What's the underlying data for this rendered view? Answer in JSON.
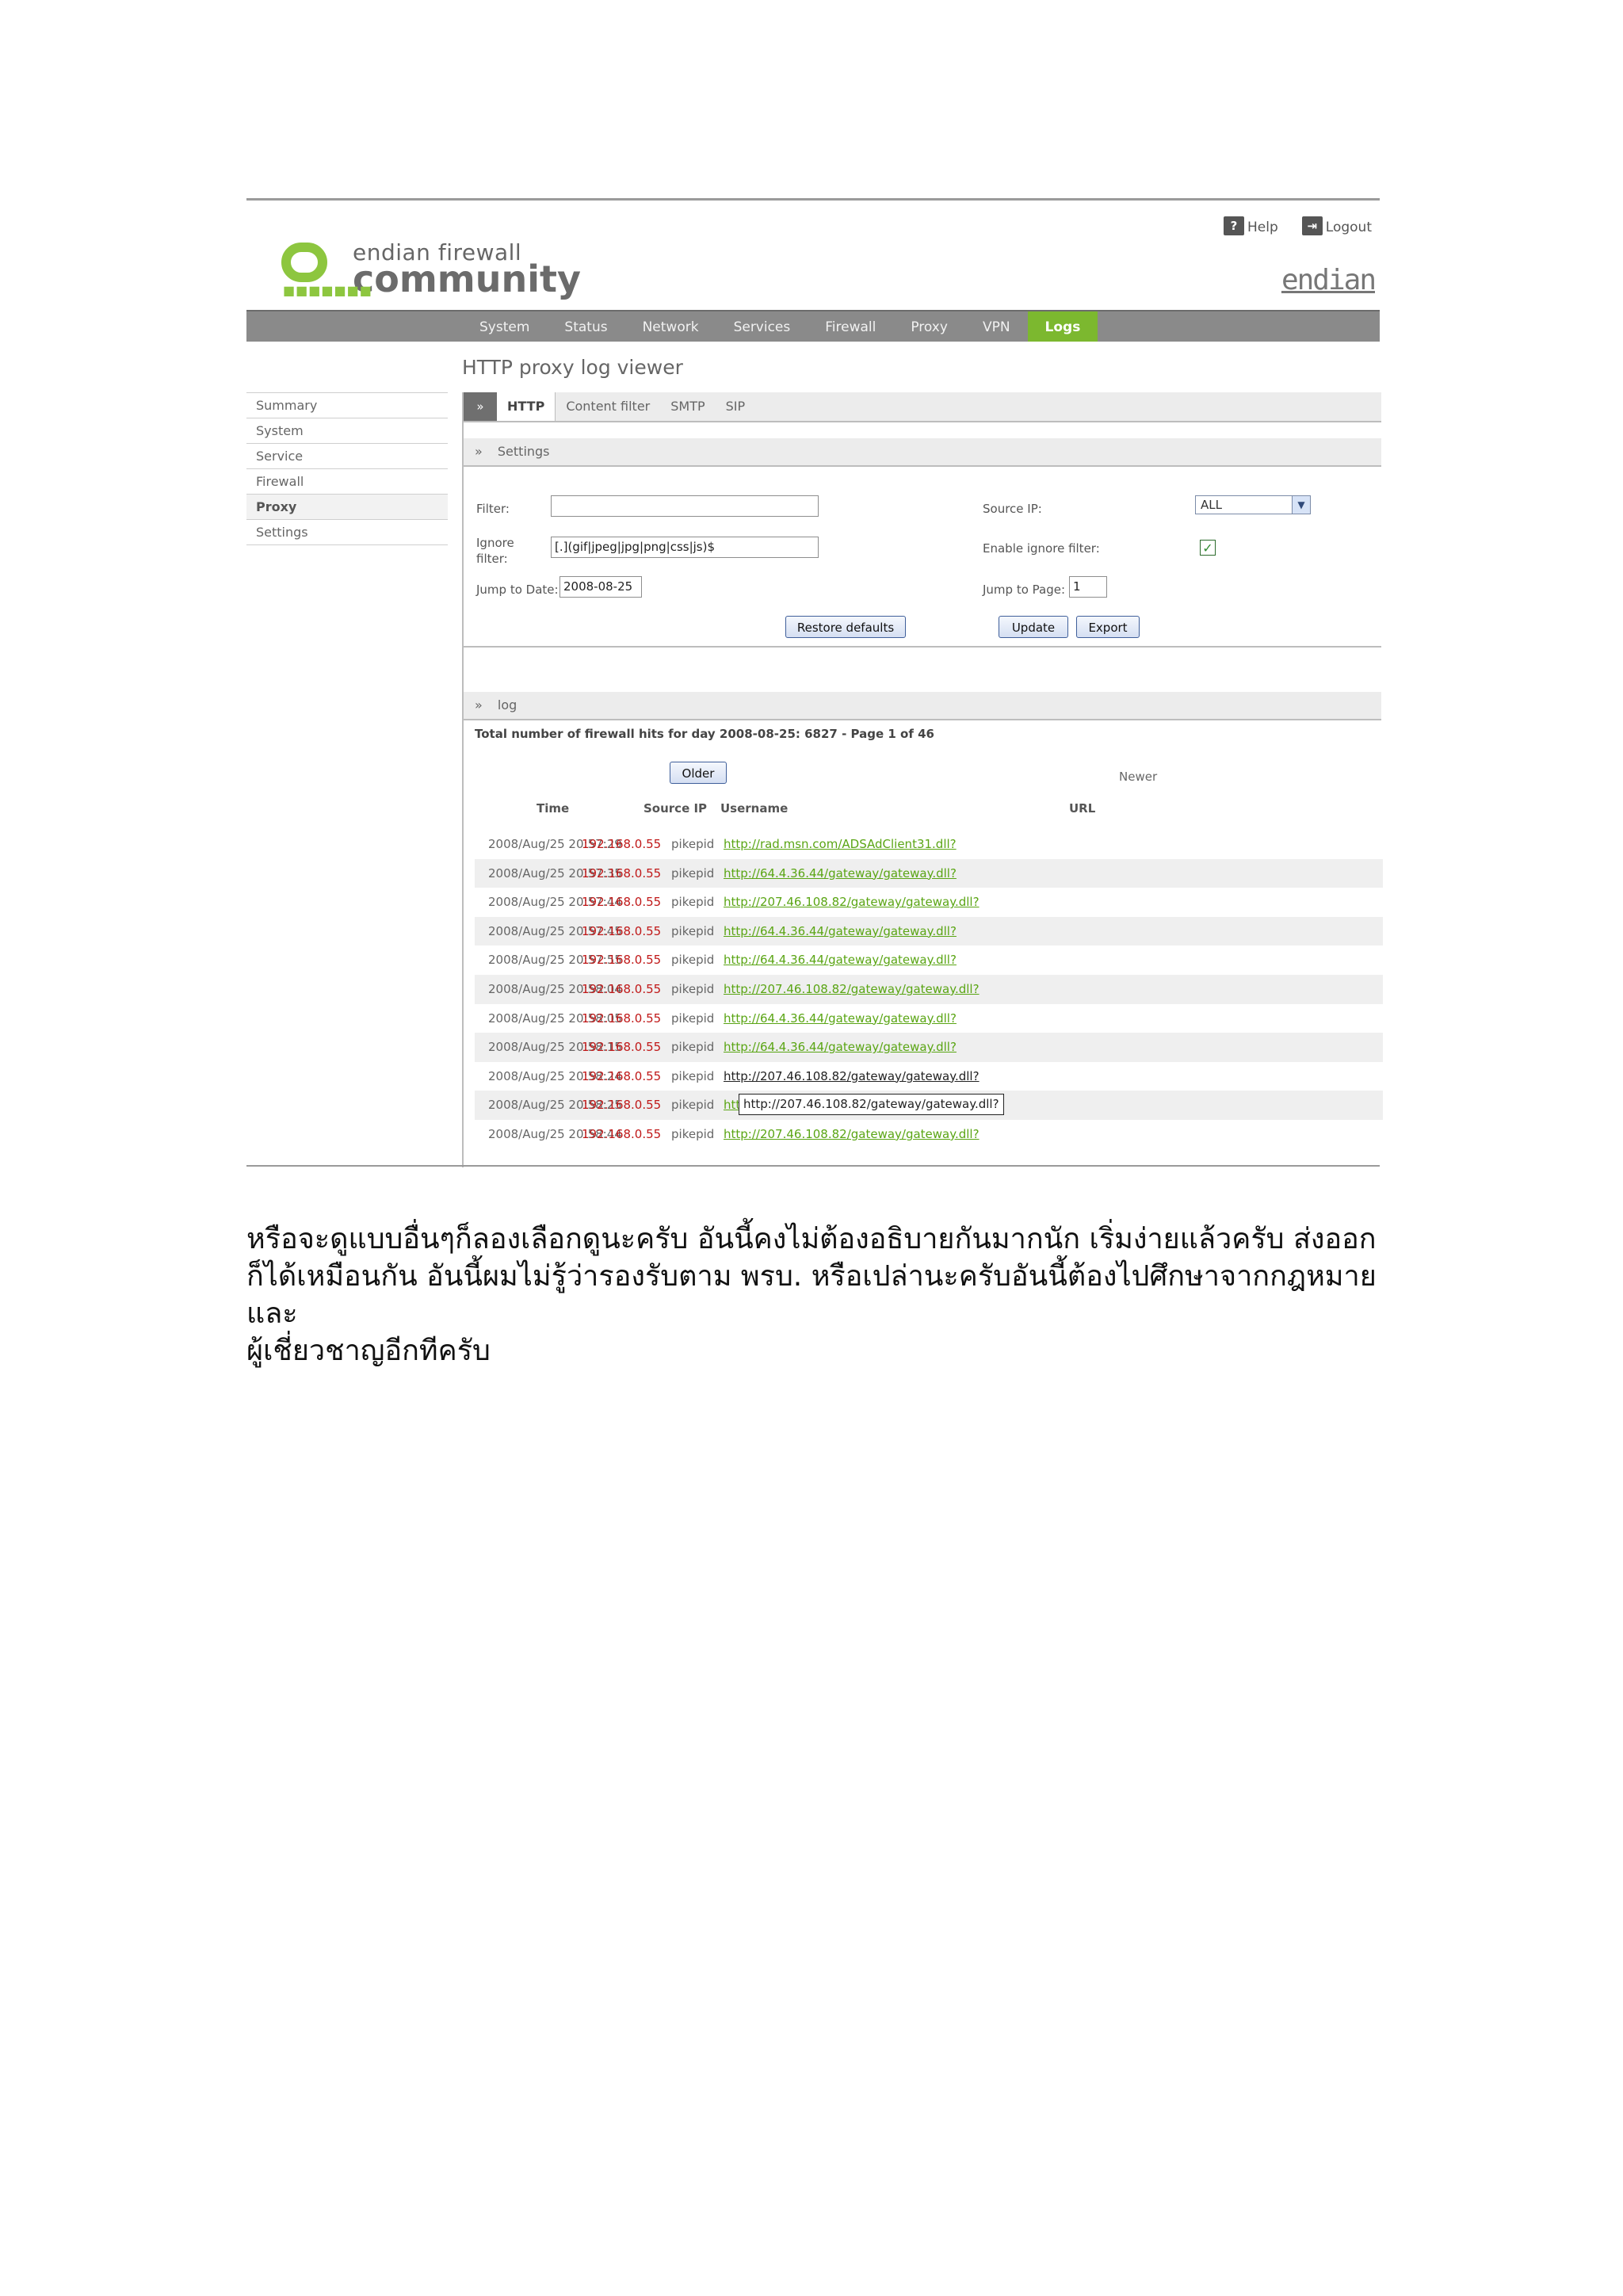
{
  "header": {
    "help_label": "Help",
    "logout_label": "Logout",
    "logo_line1": "endian firewall",
    "logo_line2": "community",
    "brand": "endian"
  },
  "nav": {
    "tabs": [
      {
        "label": "System"
      },
      {
        "label": "Status"
      },
      {
        "label": "Network"
      },
      {
        "label": "Services"
      },
      {
        "label": "Firewall"
      },
      {
        "label": "Proxy"
      },
      {
        "label": "VPN"
      },
      {
        "label": "Logs",
        "active": true
      }
    ]
  },
  "page": {
    "title": "HTTP proxy log viewer"
  },
  "sidebar": {
    "items": [
      {
        "label": "Summary"
      },
      {
        "label": "System"
      },
      {
        "label": "Service"
      },
      {
        "label": "Firewall"
      },
      {
        "label": "Proxy",
        "active": true
      },
      {
        "label": "Settings"
      }
    ]
  },
  "subtabs": {
    "arrow": "»",
    "items": [
      {
        "label": "HTTP",
        "active": true
      },
      {
        "label": "Content filter"
      },
      {
        "label": "SMTP"
      },
      {
        "label": "SIP"
      }
    ]
  },
  "settings": {
    "header": "Settings",
    "filter_label": "Filter:",
    "filter_value": "",
    "ignore_label_1": "Ignore",
    "ignore_label_2": "filter:",
    "ignore_value": "[.](gif|jpeg|jpg|png|css|js)$",
    "jump_date_label": "Jump to Date:",
    "jump_date_value": "2008-08-25",
    "source_ip_label": "Source IP:",
    "source_ip_value": "ALL",
    "enable_ignore_label": "Enable ignore filter:",
    "enable_ignore_checked": "✓",
    "jump_page_label": "Jump to Page:",
    "jump_page_value": "1",
    "restore_label": "Restore defaults",
    "update_label": "Update",
    "export_label": "Export"
  },
  "log": {
    "header": "log",
    "summary": "Total number of firewall hits for day 2008-08-25: 6827 - Page 1 of 46",
    "older_label": "Older",
    "newer_label": "Newer",
    "columns": {
      "time": "Time",
      "source_ip": "Source IP",
      "username": "Username",
      "url": "URL"
    },
    "rows": [
      {
        "time": "2008/Aug/25 20:57:29",
        "ip": "192.168.0.55",
        "user": "pikepid",
        "url": "http://rad.msn.com/ADSAdClient31.dll?"
      },
      {
        "time": "2008/Aug/25 20:57:35",
        "ip": "192.168.0.55",
        "user": "pikepid",
        "url": "http://64.4.36.44/gateway/gateway.dll?"
      },
      {
        "time": "2008/Aug/25 20:57:44",
        "ip": "192.168.0.55",
        "user": "pikepid",
        "url": "http://207.46.108.82/gateway/gateway.dll?"
      },
      {
        "time": "2008/Aug/25 20:57:45",
        "ip": "192.168.0.55",
        "user": "pikepid",
        "url": "http://64.4.36.44/gateway/gateway.dll?"
      },
      {
        "time": "2008/Aug/25 20:57:55",
        "ip": "192.168.0.55",
        "user": "pikepid",
        "url": "http://64.4.36.44/gateway/gateway.dll?"
      },
      {
        "time": "2008/Aug/25 20:58:04",
        "ip": "192.168.0.55",
        "user": "pikepid",
        "url": "http://207.46.108.82/gateway/gateway.dll?"
      },
      {
        "time": "2008/Aug/25 20:58:05",
        "ip": "192.168.0.55",
        "user": "pikepid",
        "url": "http://64.4.36.44/gateway/gateway.dll?"
      },
      {
        "time": "2008/Aug/25 20:58:15",
        "ip": "192.168.0.55",
        "user": "pikepid",
        "url": "http://64.4.36.44/gateway/gateway.dll?"
      },
      {
        "time": "2008/Aug/25 20:58:24",
        "ip": "192.168.0.55",
        "user": "pikepid",
        "url": "http://207.46.108.82/gateway/gateway.dll?"
      },
      {
        "time": "2008/Aug/25 20:58:25",
        "ip": "192.168.0.55",
        "user": "pikepid",
        "url": "htt"
      },
      {
        "time": "2008/Aug/25 20:58:44",
        "ip": "192.168.0.55",
        "user": "pikepid",
        "url": "http://207.46.108.82/gateway/gateway.dll?"
      }
    ],
    "tooltip": "http://207.46.108.82/gateway/gateway.dll?"
  },
  "caption": {
    "line1": "หรือจะดูแบบอื่นๆก็ลองเลือกดูนะครับ อันนี้คงไม่ต้องอธิบายกันมากนัก เริ่มง่ายแล้วครับ ส่งออก",
    "line2": "ก็ได้เหมือนกัน อันนี้ผมไม่รู้ว่ารองรับตาม พรบ. หรือเปล่านะครับอันนี้ต้องไปศึกษาจากกฎหมายและ",
    "line3": "ผู้เชี่ยวชาญอีกทีครับ"
  },
  "colors": {
    "accent_green": "#7cb82f",
    "link_green": "#5aa514",
    "ip_red": "#c01818",
    "nav_gray": "#8a8a8a"
  }
}
